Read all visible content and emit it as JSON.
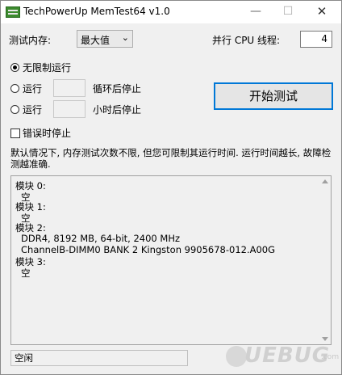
{
  "window": {
    "title": "TechPowerUp MemTest64 v1.0",
    "min_symbol": "—",
    "max_symbol": "☐",
    "close_symbol": "✕"
  },
  "memory": {
    "label": "测试内存:",
    "value": "最大值",
    "chevron": "⌄"
  },
  "cpu": {
    "label": "并行 CPU 线程:",
    "value": "4"
  },
  "options": {
    "unlimited_label": "无限制运行",
    "run_label_1": "运行",
    "cycles_label": "循环后停止",
    "run_label_2": "运行",
    "hours_label": "小时后停止",
    "stop_on_error_label": "错误时停止"
  },
  "start_button": "开始测试",
  "description": "默认情况下, 内存测试次数不限, 但您可限制其运行时间. 运行时间越长, 故障检测越准确.",
  "modules": {
    "m0": "模块 0:",
    "m0_value": "空",
    "m1": "模块 1:",
    "m1_value": "空",
    "m2": "模块 2:",
    "m2_line1": "DDR4, 8192 MB, 64-bit, 2400 MHz",
    "m2_line2": "ChannelB-DIMM0 BANK 2 Kingston 9905678-012.A00G",
    "m3": "模块 3:",
    "m3_value": "空"
  },
  "status": "空闲",
  "watermark": {
    "text": "UEBUG",
    "suffix": ".com"
  }
}
